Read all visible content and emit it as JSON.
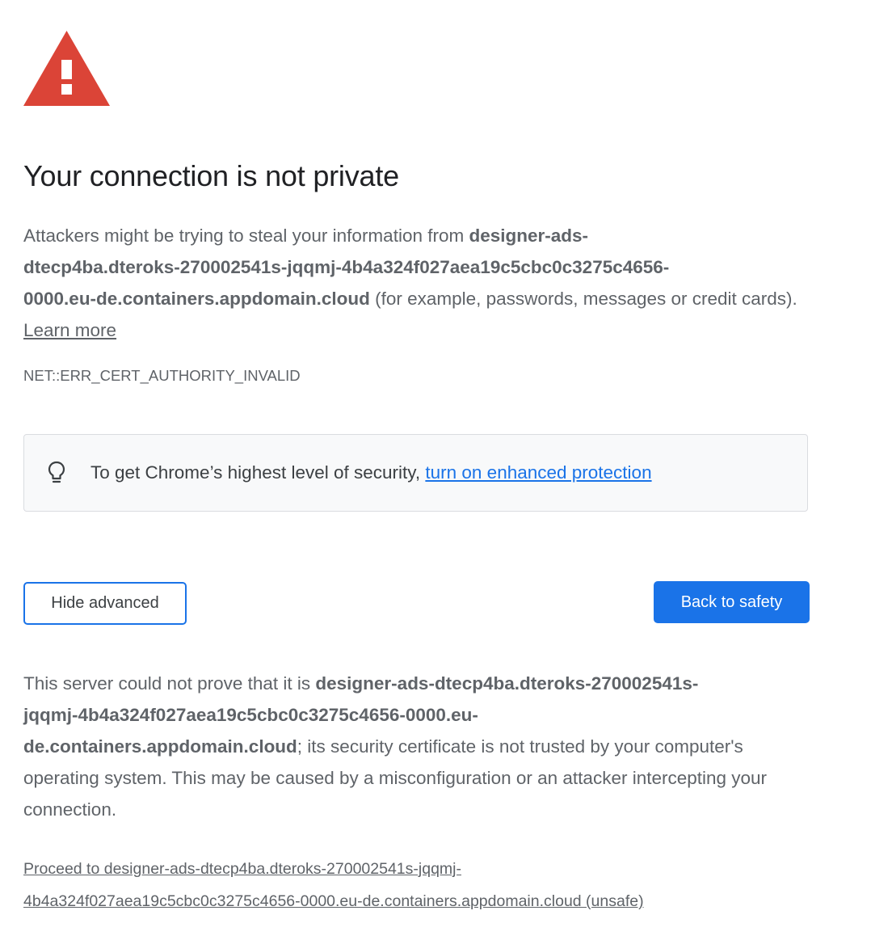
{
  "icons": {
    "warning": "warning-triangle-icon",
    "bulb": "lightbulb-icon"
  },
  "colors": {
    "warning_red": "#db4437",
    "primary_blue": "#1a73e8",
    "text_gray": "#5f6368",
    "heading": "#202124"
  },
  "header": {
    "title": "Your connection is not private"
  },
  "main": {
    "intro_prefix": "Attackers might be trying to steal your information from ",
    "domain_line1": "designer-ads-",
    "domain_line2": "dtecp4ba.dteroks-270002541s-jqqmj-4b4a324f027aea19c5cbc0c3275c4656-",
    "domain_line3": "0000.eu-de.containers.appdomain.cloud",
    "intro_suffix": " (for example, passwords, messages or credit cards). ",
    "learn_more": "Learn more",
    "error_code": "NET::ERR_CERT_AUTHORITY_INVALID"
  },
  "enhanced": {
    "text": "To get Chrome’s highest level of security, ",
    "link": "turn on enhanced protection"
  },
  "buttons": {
    "hide_advanced": "Hide advanced",
    "back_to_safety": "Back to safety"
  },
  "details": {
    "prefix": "This server could not prove that it is ",
    "domain_line1": "designer-ads-dtecp4ba.dteroks-270002541s-",
    "domain_line2": "jqqmj-4b4a324f027aea19c5cbc0c3275c4656-0000.eu-",
    "domain_line3": "de.containers.appdomain.cloud",
    "suffix": "; its security certificate is not trusted by your computer's operating system. This may be caused by a misconfiguration or an attacker intercepting your connection."
  },
  "proceed": {
    "line1": "Proceed to designer-ads-dtecp4ba.dteroks-270002541s-jqqmj-",
    "line2": "4b4a324f027aea19c5cbc0c3275c4656-0000.eu-de.containers.appdomain.cloud (unsafe)"
  }
}
